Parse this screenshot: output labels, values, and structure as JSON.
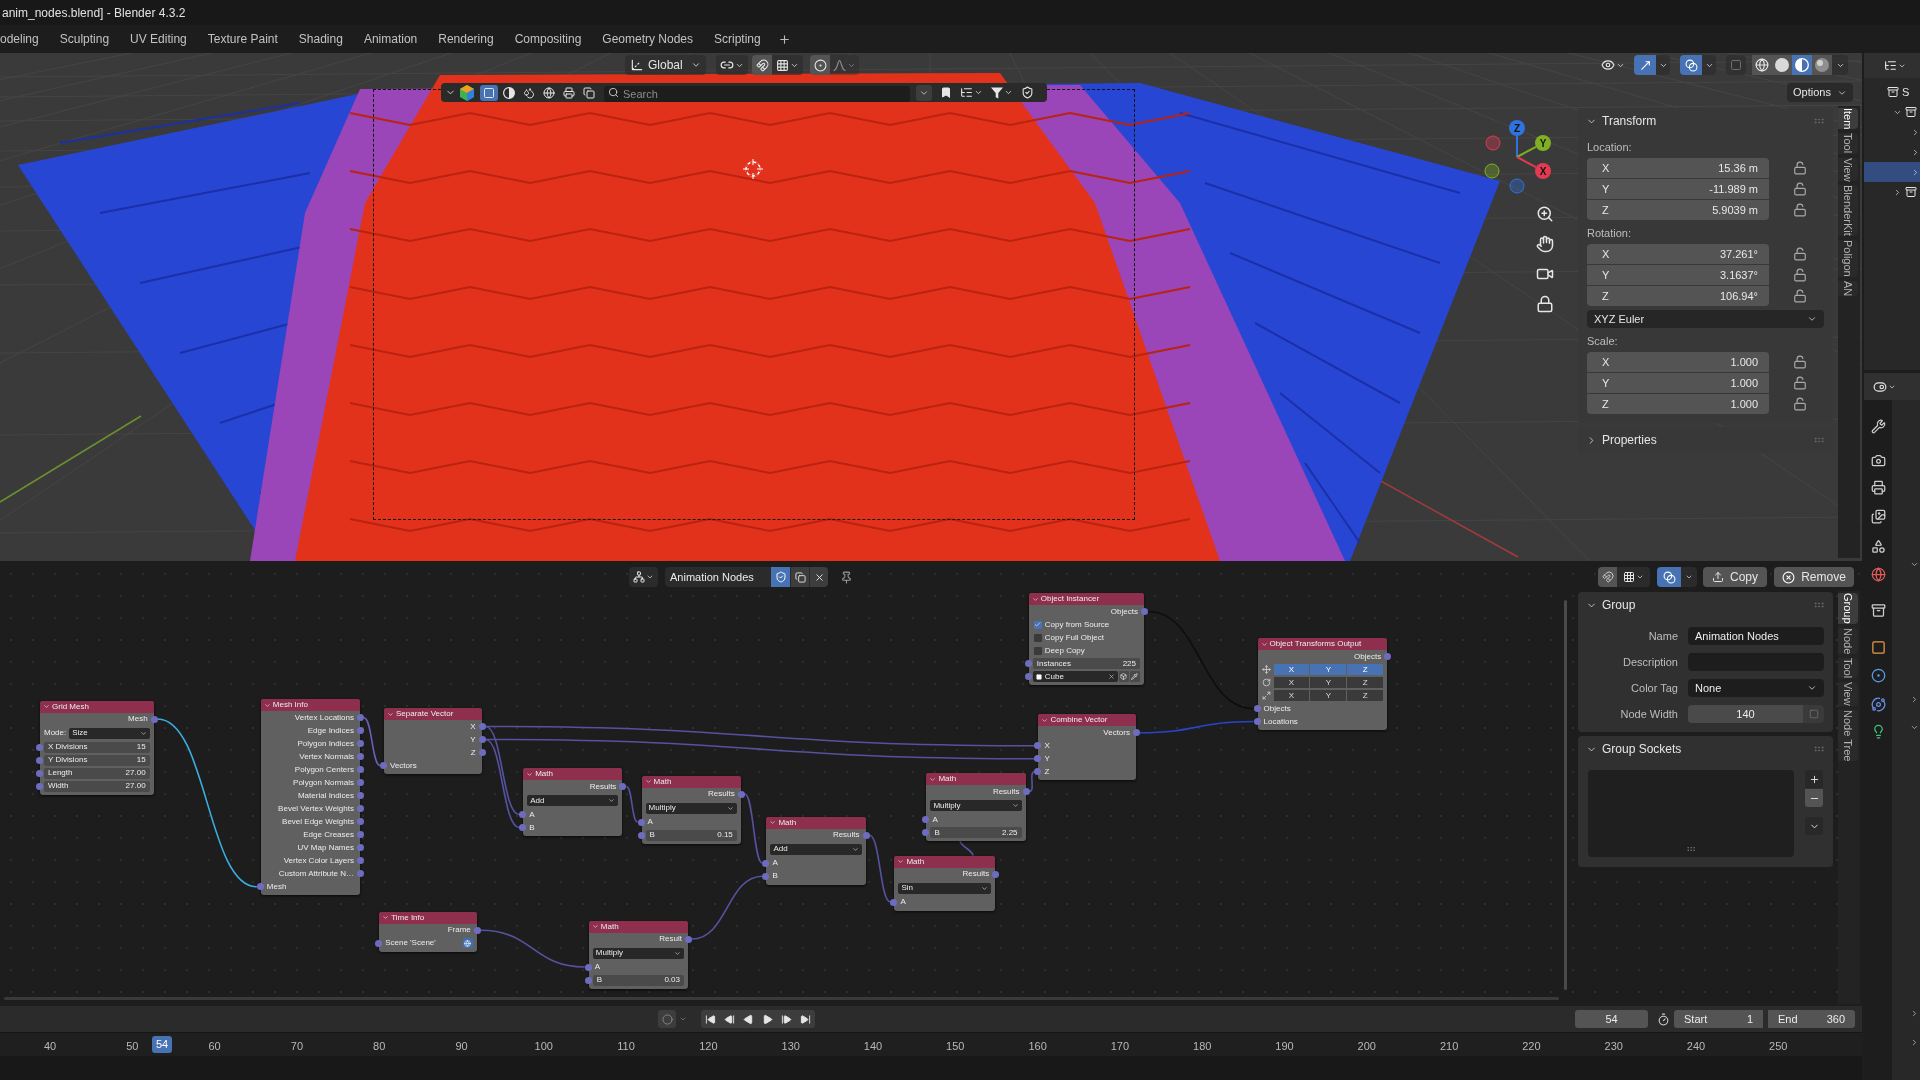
{
  "title_bar": {
    "title": "anim_nodes.blend] - Blender 4.3.2"
  },
  "workspaces": [
    {
      "label": "odeling",
      "selected": false
    },
    {
      "label": "Sculpting",
      "selected": false
    },
    {
      "label": "UV Editing",
      "selected": false
    },
    {
      "label": "Texture Paint",
      "selected": false
    },
    {
      "label": "Shading",
      "selected": false
    },
    {
      "label": "Animation",
      "selected": false
    },
    {
      "label": "Rendering",
      "selected": false
    },
    {
      "label": "Compositing",
      "selected": false
    },
    {
      "label": "Geometry Nodes",
      "selected": false
    },
    {
      "label": "Scripting",
      "selected": false
    }
  ],
  "viewport": {
    "header": {
      "orientation": "Global",
      "snapping": false,
      "proportional_editing": false,
      "gizmos": true,
      "overlays": true,
      "xray": false,
      "shading": [
        {
          "kind": "wireframe",
          "selected": false
        },
        {
          "kind": "solid",
          "selected": false
        },
        {
          "kind": "material",
          "selected": true
        },
        {
          "kind": "rendered",
          "selected": false
        }
      ],
      "options": "Options"
    },
    "asset_bar": {
      "types": [
        {
          "kind": "model",
          "selected": true
        },
        {
          "kind": "material",
          "selected": false
        },
        {
          "kind": "brush",
          "selected": false
        },
        {
          "kind": "hdr",
          "selected": false
        },
        {
          "kind": "printable",
          "selected": false
        },
        {
          "kind": "scene",
          "selected": false
        }
      ],
      "search": {
        "placeholder": "Search"
      }
    },
    "gizmo": [
      {
        "label": "Z",
        "color": "#2f73e0"
      },
      {
        "label": "Y",
        "color": "#7fb024"
      },
      {
        "label": "X",
        "color": "#e23a52"
      }
    ],
    "sidebar": {
      "tabs": [
        {
          "label": "Item",
          "selected": true
        },
        {
          "label": "Tool",
          "selected": false
        },
        {
          "label": "View",
          "selected": false
        },
        {
          "label": "BlenderKit",
          "selected": false
        },
        {
          "label": "Poligon",
          "selected": false
        },
        {
          "label": "AN",
          "selected": false
        }
      ],
      "panels": [
        {
          "title": "Transform",
          "expanded": true,
          "rows": [
            {
              "kind": "label",
              "text": "Location:"
            },
            {
              "kind": "vector",
              "fields": [
                {
                  "axis": "X",
                  "value": "15.36 m"
                },
                {
                  "axis": "Y",
                  "value": "-11.989 m"
                },
                {
                  "axis": "Z",
                  "value": "5.9039 m"
                }
              ]
            },
            {
              "kind": "label",
              "text": "Rotation:"
            },
            {
              "kind": "vector",
              "fields": [
                {
                  "axis": "X",
                  "value": "37.261°"
                },
                {
                  "axis": "Y",
                  "value": "3.1637°"
                },
                {
                  "axis": "Z",
                  "value": "106.94°"
                }
              ]
            },
            {
              "kind": "select",
              "value": "XYZ Euler"
            },
            {
              "kind": "label",
              "text": "Scale:"
            },
            {
              "kind": "vector",
              "fields": [
                {
                  "axis": "X",
                  "value": "1.000"
                },
                {
                  "axis": "Y",
                  "value": "1.000"
                },
                {
                  "axis": "Z",
                  "value": "1.000"
                }
              ]
            }
          ]
        },
        {
          "title": "Properties",
          "expanded": false
        }
      ]
    }
  },
  "node_editor": {
    "header": {
      "tree_name": "Animation Nodes",
      "fake_user": true,
      "snapping": false,
      "overlays": true,
      "buttons": [
        {
          "kind": "copy",
          "label": "Copy"
        },
        {
          "kind": "remove",
          "label": "Remove"
        }
      ]
    },
    "nodes": [
      {
        "title": "Grid Mesh",
        "rows": [
          {
            "kind": "output",
            "label": "Mesh"
          },
          {
            "kind": "select",
            "label": "Mode:",
            "value": "Size"
          },
          {
            "kind": "number",
            "label": "X Divisions",
            "value": "15"
          },
          {
            "kind": "number",
            "label": "Y Divisions",
            "value": "15"
          },
          {
            "kind": "number",
            "label": "Length",
            "value": "27.00"
          },
          {
            "kind": "number",
            "label": "Width",
            "value": "27.00"
          }
        ]
      },
      {
        "title": "Mesh Info",
        "rows": [
          {
            "kind": "output",
            "label": "Vertex Locations"
          },
          {
            "kind": "output",
            "label": "Edge Indices"
          },
          {
            "kind": "output",
            "label": "Polygon Indices"
          },
          {
            "kind": "output",
            "label": "Vertex Normals"
          },
          {
            "kind": "output",
            "label": "Polygon Centers"
          },
          {
            "kind": "output",
            "label": "Polygon Normals"
          },
          {
            "kind": "output",
            "label": "Material Indices"
          },
          {
            "kind": "output",
            "label": "Bevel Vertex Weights"
          },
          {
            "kind": "output",
            "label": "Bevel Edge Weights"
          },
          {
            "kind": "output",
            "label": "Edge Creases"
          },
          {
            "kind": "output",
            "label": "UV Map Names"
          },
          {
            "kind": "output",
            "label": "Vertex Color Layers"
          },
          {
            "kind": "output",
            "label": "Custom Attribute N…"
          },
          {
            "kind": "input",
            "label": "Mesh"
          }
        ]
      },
      {
        "title": "Separate Vector",
        "rows": [
          {
            "kind": "output",
            "label": "X"
          },
          {
            "kind": "output",
            "label": "Y"
          },
          {
            "kind": "output",
            "label": "Z"
          },
          {
            "kind": "input",
            "label": "Vectors"
          }
        ]
      },
      {
        "title": "Time Info",
        "rows": [
          {
            "kind": "output",
            "label": "Frame"
          },
          {
            "kind": "scene",
            "label": "Scene 'Scene'"
          }
        ]
      },
      {
        "title": "Math",
        "rows": [
          {
            "kind": "output",
            "label": "Results"
          },
          {
            "kind": "select",
            "value": "Add"
          },
          {
            "kind": "input",
            "label": "A"
          },
          {
            "kind": "input",
            "label": "B"
          }
        ]
      },
      {
        "title": "Math",
        "rows": [
          {
            "kind": "output",
            "label": "Results"
          },
          {
            "kind": "select",
            "value": "Multiply"
          },
          {
            "kind": "input",
            "label": "A"
          },
          {
            "kind": "number",
            "label": "B",
            "value": "0.15"
          }
        ]
      },
      {
        "title": "Math",
        "rows": [
          {
            "kind": "output",
            "label": "Result"
          },
          {
            "kind": "select",
            "value": "Multiply"
          },
          {
            "kind": "input",
            "label": "A"
          },
          {
            "kind": "number",
            "label": "B",
            "value": "0.03"
          }
        ]
      },
      {
        "title": "Math",
        "rows": [
          {
            "kind": "output",
            "label": "Results"
          },
          {
            "kind": "select",
            "value": "Add"
          },
          {
            "kind": "input",
            "label": "A"
          },
          {
            "kind": "input",
            "label": "B"
          }
        ]
      },
      {
        "title": "Math",
        "rows": [
          {
            "kind": "output",
            "label": "Results"
          },
          {
            "kind": "select",
            "value": "Sin"
          },
          {
            "kind": "input",
            "label": "A"
          }
        ]
      },
      {
        "title": "Math",
        "rows": [
          {
            "kind": "output",
            "label": "Results"
          },
          {
            "kind": "select",
            "value": "Multiply"
          },
          {
            "kind": "input",
            "label": "A"
          },
          {
            "kind": "number",
            "label": "B",
            "value": "2.25"
          }
        ]
      },
      {
        "title": "Object Instancer",
        "rows": [
          {
            "kind": "output",
            "label": "Objects"
          },
          {
            "kind": "checkbox",
            "label": "Copy from Source",
            "checked": true
          },
          {
            "kind": "checkbox",
            "label": "Copy Full Object",
            "checked": false
          },
          {
            "kind": "checkbox",
            "label": "Deep Copy",
            "checked": false
          },
          {
            "kind": "number",
            "label": "Instances",
            "value": "225"
          },
          {
            "kind": "object",
            "value": "Cube"
          }
        ]
      },
      {
        "title": "Combine Vector",
        "rows": [
          {
            "kind": "output",
            "label": "Vectors"
          },
          {
            "kind": "input",
            "label": "X"
          },
          {
            "kind": "input",
            "label": "Y"
          },
          {
            "kind": "input",
            "label": "Z"
          }
        ]
      },
      {
        "title": "Object Transforms Output",
        "rows": [
          {
            "kind": "output",
            "label": "Objects"
          },
          {
            "kind": "toggles",
            "toggles": [
              {
                "label": "X",
                "selected": true
              },
              {
                "label": "Y",
                "selected": true
              },
              {
                "label": "Z",
                "selected": true
              }
            ]
          },
          {
            "kind": "toggles",
            "toggles": [
              {
                "label": "X",
                "selected": false
              },
              {
                "label": "Y",
                "selected": false
              },
              {
                "label": "Z",
                "selected": false
              }
            ]
          },
          {
            "kind": "toggles",
            "toggles": [
              {
                "label": "X",
                "selected": false
              },
              {
                "label": "Y",
                "selected": false
              },
              {
                "label": "Z",
                "selected": false
              }
            ]
          },
          {
            "kind": "input",
            "label": "Objects"
          },
          {
            "kind": "input",
            "label": "Locations"
          }
        ]
      }
    ],
    "sidebar": {
      "tabs": [
        {
          "label": "Group",
          "selected": true
        },
        {
          "label": "Node",
          "selected": false
        },
        {
          "label": "Tool",
          "selected": false
        },
        {
          "label": "View",
          "selected": false
        },
        {
          "label": "Node Tree",
          "selected": false
        }
      ],
      "group": {
        "title": "Group",
        "expanded": true,
        "fields": [
          {
            "label": "Name",
            "kind": "text",
            "value": "Animation Nodes"
          },
          {
            "label": "Description",
            "kind": "text"
          },
          {
            "label": "Color Tag",
            "kind": "select",
            "value": "None"
          },
          {
            "label": "Node Width",
            "kind": "number",
            "value": "140"
          }
        ]
      },
      "group_sockets": {
        "title": "Group Sockets",
        "expanded": true
      }
    }
  },
  "timeline": {
    "auto_keying": false,
    "current_frame": "54",
    "range": [
      {
        "label": "Start",
        "value": "1"
      },
      {
        "label": "End",
        "value": "360"
      }
    ],
    "ruler": [
      "40",
      "50",
      "60",
      "70",
      "80",
      "90",
      "100",
      "110",
      "120",
      "130",
      "140",
      "150",
      "160",
      "170",
      "180",
      "190",
      "200",
      "210",
      "220",
      "230",
      "240",
      "250"
    ],
    "current_frame_marker": "54"
  },
  "outliner": {
    "rows": [
      {
        "label": "S",
        "selected": false,
        "children": [
          {
            "selected": false,
            "expanded": true,
            "children": [
              {
                "selected": false,
                "expanded": false
              },
              {
                "selected": false,
                "expanded": false
              },
              {
                "selected": true,
                "expanded": false
              }
            ]
          },
          {
            "selected": false,
            "expanded": false
          }
        ]
      }
    ]
  }
}
